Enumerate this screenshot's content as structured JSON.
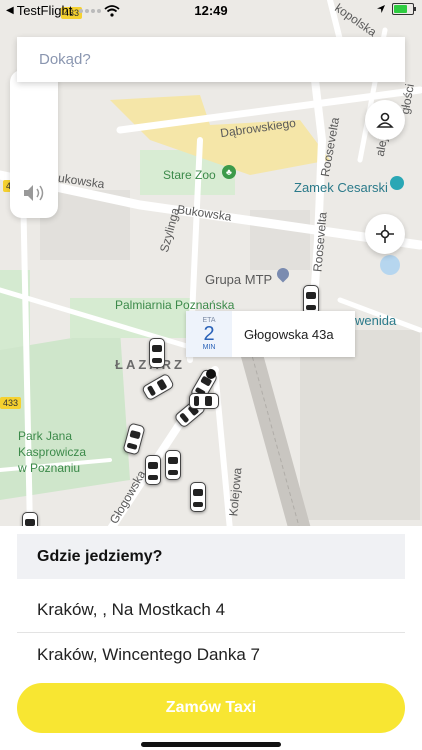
{
  "status_bar": {
    "back_app": "TestFlight",
    "time": "12:49",
    "battery_level": 0.8,
    "battery_color": "#2ecc40"
  },
  "search": {
    "placeholder": "Dokąd?"
  },
  "map": {
    "labels": {
      "stare_zoo": "Stare Zoo",
      "zamek": "Zamek Cesarski",
      "grupa_mtp": "Grupa MTP",
      "palmiarnia": "Palmiarnia Poznańska",
      "lazarz": "ŁAZARZ",
      "park": "Park Jana\nKasprowicza\nw Poznaniu",
      "wenida": "wenida"
    },
    "streets": {
      "dabrowskiego": "Dąbrowskiego",
      "bukowska_1": "ukowska",
      "bukowska_2": "Bukowska",
      "roosevelta_1": "Roosevelta",
      "roosevelta_2": "Roosevelta",
      "szylinga": "Szylinga",
      "glogowska": "Głogowska",
      "kolejowa": "Kolejowa",
      "kopolska": "kopolska",
      "alej": "alej",
      "glosci": "głości"
    },
    "road_shields": [
      "433",
      "43",
      "433"
    ],
    "pickup": {
      "eta_label": "ETA",
      "eta_value": "2",
      "eta_unit": "MIN",
      "address": "Głogowska 43a"
    }
  },
  "sheet": {
    "title": "Gdzie jedziemy?",
    "recent": [
      "Kraków, , Na Mostkach 4",
      "Kraków, Wincentego Danka 7"
    ],
    "order_button": "Zamów Taxi",
    "accent": "#f8e632"
  }
}
